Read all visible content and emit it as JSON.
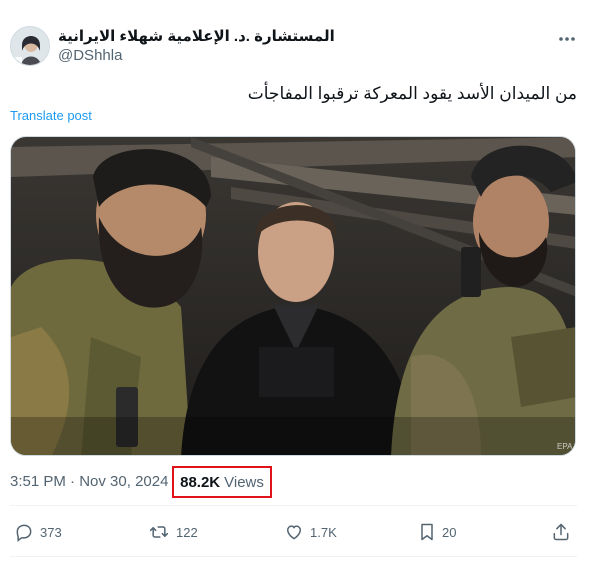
{
  "author": {
    "display_name": "المستشارة .د. الإعلامية شهلاء الايرانية",
    "handle": "@DShhla"
  },
  "post": {
    "text": "من الميدان الأسد يقود المعركة ترقبوا المفاجأت",
    "translate_label": "Translate post",
    "media_watermark": "EPA"
  },
  "meta": {
    "time": "3:51 PM",
    "separator": " · ",
    "date": "Nov 30, 2024",
    "views_count": "88.2K",
    "views_label": "Views"
  },
  "actions": {
    "replies": "373",
    "reposts": "122",
    "likes": "1.7K",
    "bookmarks": "20"
  },
  "colors": {
    "accent": "#1d9bf0",
    "highlight_border": "#e0131a",
    "secondary_text": "#536471"
  }
}
